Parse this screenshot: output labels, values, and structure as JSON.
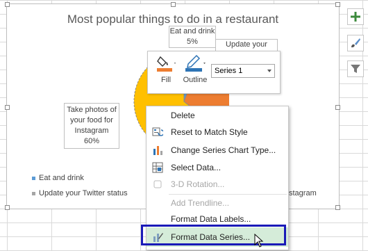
{
  "chart": {
    "title": "Most popular things to do in a restaurant",
    "labels": {
      "eat_drink": "Eat and drink",
      "eat_drink_pct": "5%",
      "update_twitter_partial": "Update your",
      "photos_line1": "Take photos of",
      "photos_line2": "your food for",
      "photos_line3": "Instagram",
      "photos_pct": "60%"
    },
    "legend": {
      "item1": "Eat and drink",
      "item2": "Update your Twitter status",
      "item3_partial": "stagram"
    },
    "colors": {
      "series_orange": "#ed7d31",
      "series_yellow": "#ffc000",
      "series_gray": "#a5a5a5",
      "series_blue": "#5b9bd5"
    }
  },
  "chart_data": {
    "type": "pie",
    "title": "Most popular things to do in a restaurant",
    "categories": [
      "Eat and drink",
      "Update your Twitter status",
      "Take photos of your food for Instagram"
    ],
    "values": [
      5,
      null,
      60
    ]
  },
  "side_buttons": {
    "elements": "plus-icon",
    "styles": "brush-icon",
    "filters": "filter-icon"
  },
  "mini_toolbar": {
    "fill_label": "Fill",
    "outline_label": "Outline",
    "series_value": "Series 1"
  },
  "context_menu": {
    "items": [
      {
        "label": "Delete",
        "icon": "delete-icon",
        "disabled": false
      },
      {
        "label": "Reset to Match Style",
        "icon": "reset-style-icon",
        "disabled": false
      },
      {
        "label": "Change Series Chart Type...",
        "icon": "chart-type-icon",
        "disabled": false
      },
      {
        "label": "Select Data...",
        "icon": "select-data-icon",
        "disabled": false
      },
      {
        "label": "3-D Rotation...",
        "icon": "rotation-icon",
        "disabled": true
      },
      {
        "label": "Add Trendline...",
        "icon": "",
        "disabled": true
      },
      {
        "label": "Format Data Labels...",
        "icon": "",
        "disabled": false
      },
      {
        "label": "Format Data Series...",
        "icon": "format-series-icon",
        "disabled": false
      }
    ]
  }
}
